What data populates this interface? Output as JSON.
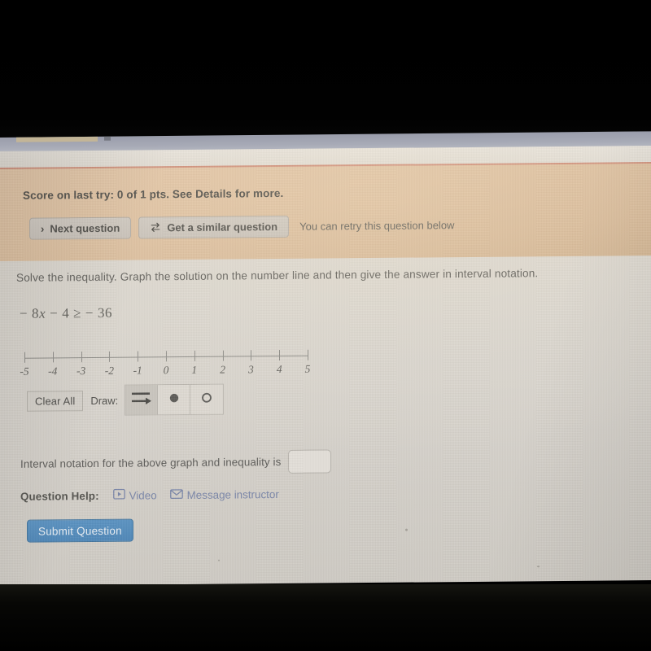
{
  "banner": {
    "score_text": "Score on last try: 0 of 1 pts. See Details for more.",
    "next_question_label": "Next question",
    "next_question_icon": "chevron-right-icon",
    "similar_question_label": "Get a similar question",
    "similar_question_icon": "refresh-cycle-icon",
    "retry_note": "You can retry this question below",
    "background_color": "#dfc2a2",
    "top_border_color": "#cf8d78"
  },
  "question": {
    "prompt": "Solve the inequality. Graph the solution on the number line and then give the answer in interval notation.",
    "equation": "− 8x − 4 ≥ − 36",
    "equation_lhs_coeff": "− 8",
    "equation_var": "x",
    "equation_rest": "− 4 ≥ − 36"
  },
  "number_line": {
    "min": -5,
    "max": 5,
    "step": 1,
    "tick_labels": [
      "-5",
      "-4",
      "-3",
      "-2",
      "-1",
      "0",
      "1",
      "2",
      "3",
      "4",
      "5"
    ],
    "axis_color": "#8e8d89",
    "drawn_solution": "none"
  },
  "draw_toolbar": {
    "clear_all_label": "Clear All",
    "draw_label": "Draw:",
    "tools": [
      {
        "name": "ray-arrow-tool",
        "icon": "ray-right-arrow-icon",
        "selected": true
      },
      {
        "name": "closed-dot-tool",
        "icon": "filled-circle-icon",
        "selected": false
      },
      {
        "name": "open-dot-tool",
        "icon": "open-circle-icon",
        "selected": false
      }
    ]
  },
  "interval": {
    "label": "Interval notation for the above graph and inequality is",
    "value": "",
    "placeholder": ""
  },
  "help": {
    "label": "Question Help:",
    "video_label": "Video",
    "video_icon": "video-play-icon",
    "message_label": "Message instructor",
    "message_icon": "envelope-icon",
    "link_color": "#7a86a8"
  },
  "submit": {
    "label": "Submit Question",
    "color": "#4f87b8"
  }
}
